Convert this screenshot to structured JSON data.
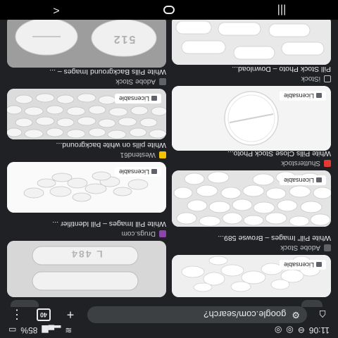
{
  "status_bar": {
    "time": "11:06",
    "battery": "85%"
  },
  "browser": {
    "url": "google.com/search?",
    "tab_count": "40",
    "home_icon": "home-icon",
    "plus_icon": "plus-icon",
    "menu_icon": "more-vert-icon"
  },
  "results": {
    "left_column": [
      {
        "source": "Adobe Stock",
        "title": "White Pill\" Images – Browse 589...",
        "badge": "Licensable",
        "favicon_color": "#5f6368"
      },
      {
        "source": "Shutterstock",
        "title": "White Pills Close Stock Photo...",
        "badge": "Licensable",
        "favicon_color": "#e53935"
      },
      {
        "source": "iStock",
        "title": "Pill Stock Photo – Download...",
        "badge": "Licensable",
        "favicon_color": "#202124"
      }
    ],
    "right_column": [
      {
        "source": "Drugs.com",
        "title": "White Pill Images – Pill Identifier ...",
        "favicon_color": "#8e44ad"
      },
      {
        "source": "Westend61",
        "title": "White pills on white background...",
        "badge": "Licensable",
        "favicon_color": "#f5c400"
      },
      {
        "source": "Adobe Stock",
        "title": "White Pills Background Images – ...",
        "badge": "Licensable",
        "favicon_color": "#5f6368"
      }
    ],
    "pill_imprints": {
      "drugs_com": "L 484",
      "bottom_pill": "512"
    }
  },
  "nav_bar": {
    "recents_icon": "recents-icon",
    "home_icon": "nav-home-icon",
    "back_icon": "back-icon"
  }
}
